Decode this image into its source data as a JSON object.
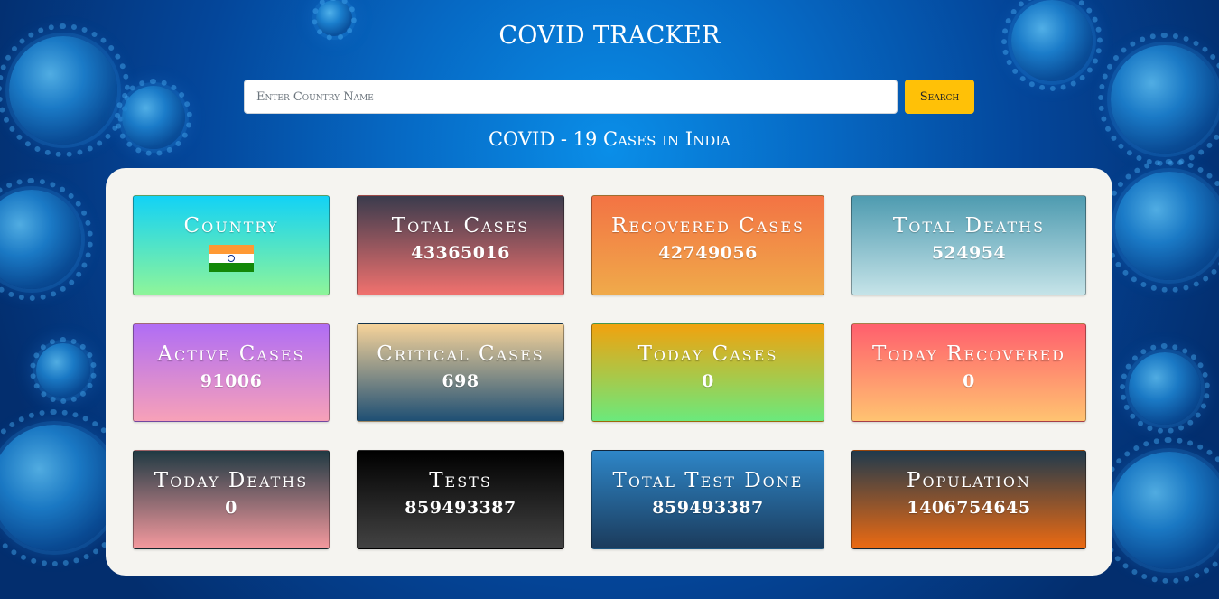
{
  "header": {
    "title": "COVID TRACKER"
  },
  "search": {
    "placeholder": "Enter Country Name",
    "value": "",
    "button_label": "Search"
  },
  "subtitle": "COVID - 19 Cases in India",
  "cards": {
    "country": {
      "label": "Country",
      "flag": "india-flag-icon"
    },
    "total_cases": {
      "label": "Total Cases",
      "value": "43365016"
    },
    "recovered_cases": {
      "label": "Recovered Cases",
      "value": "42749056"
    },
    "total_deaths": {
      "label": "Total Deaths",
      "value": "524954"
    },
    "active_cases": {
      "label": "Active Cases",
      "value": "91006"
    },
    "critical_cases": {
      "label": "Critical Cases",
      "value": "698"
    },
    "today_cases": {
      "label": "Today Cases",
      "value": "0"
    },
    "today_recovered": {
      "label": "Today Recovered",
      "value": "0"
    },
    "today_deaths": {
      "label": "Today Deaths",
      "value": "0"
    },
    "tests": {
      "label": "Tests",
      "value": "859493387"
    },
    "total_test_done": {
      "label": "Total Test Done",
      "value": "859493387"
    },
    "population": {
      "label": "Population",
      "value": "1406754645"
    }
  },
  "colors": {
    "search_button": "#ffc107",
    "panel": "#f5f4f0",
    "flag_saffron": "#ff9933",
    "flag_green": "#138808"
  }
}
